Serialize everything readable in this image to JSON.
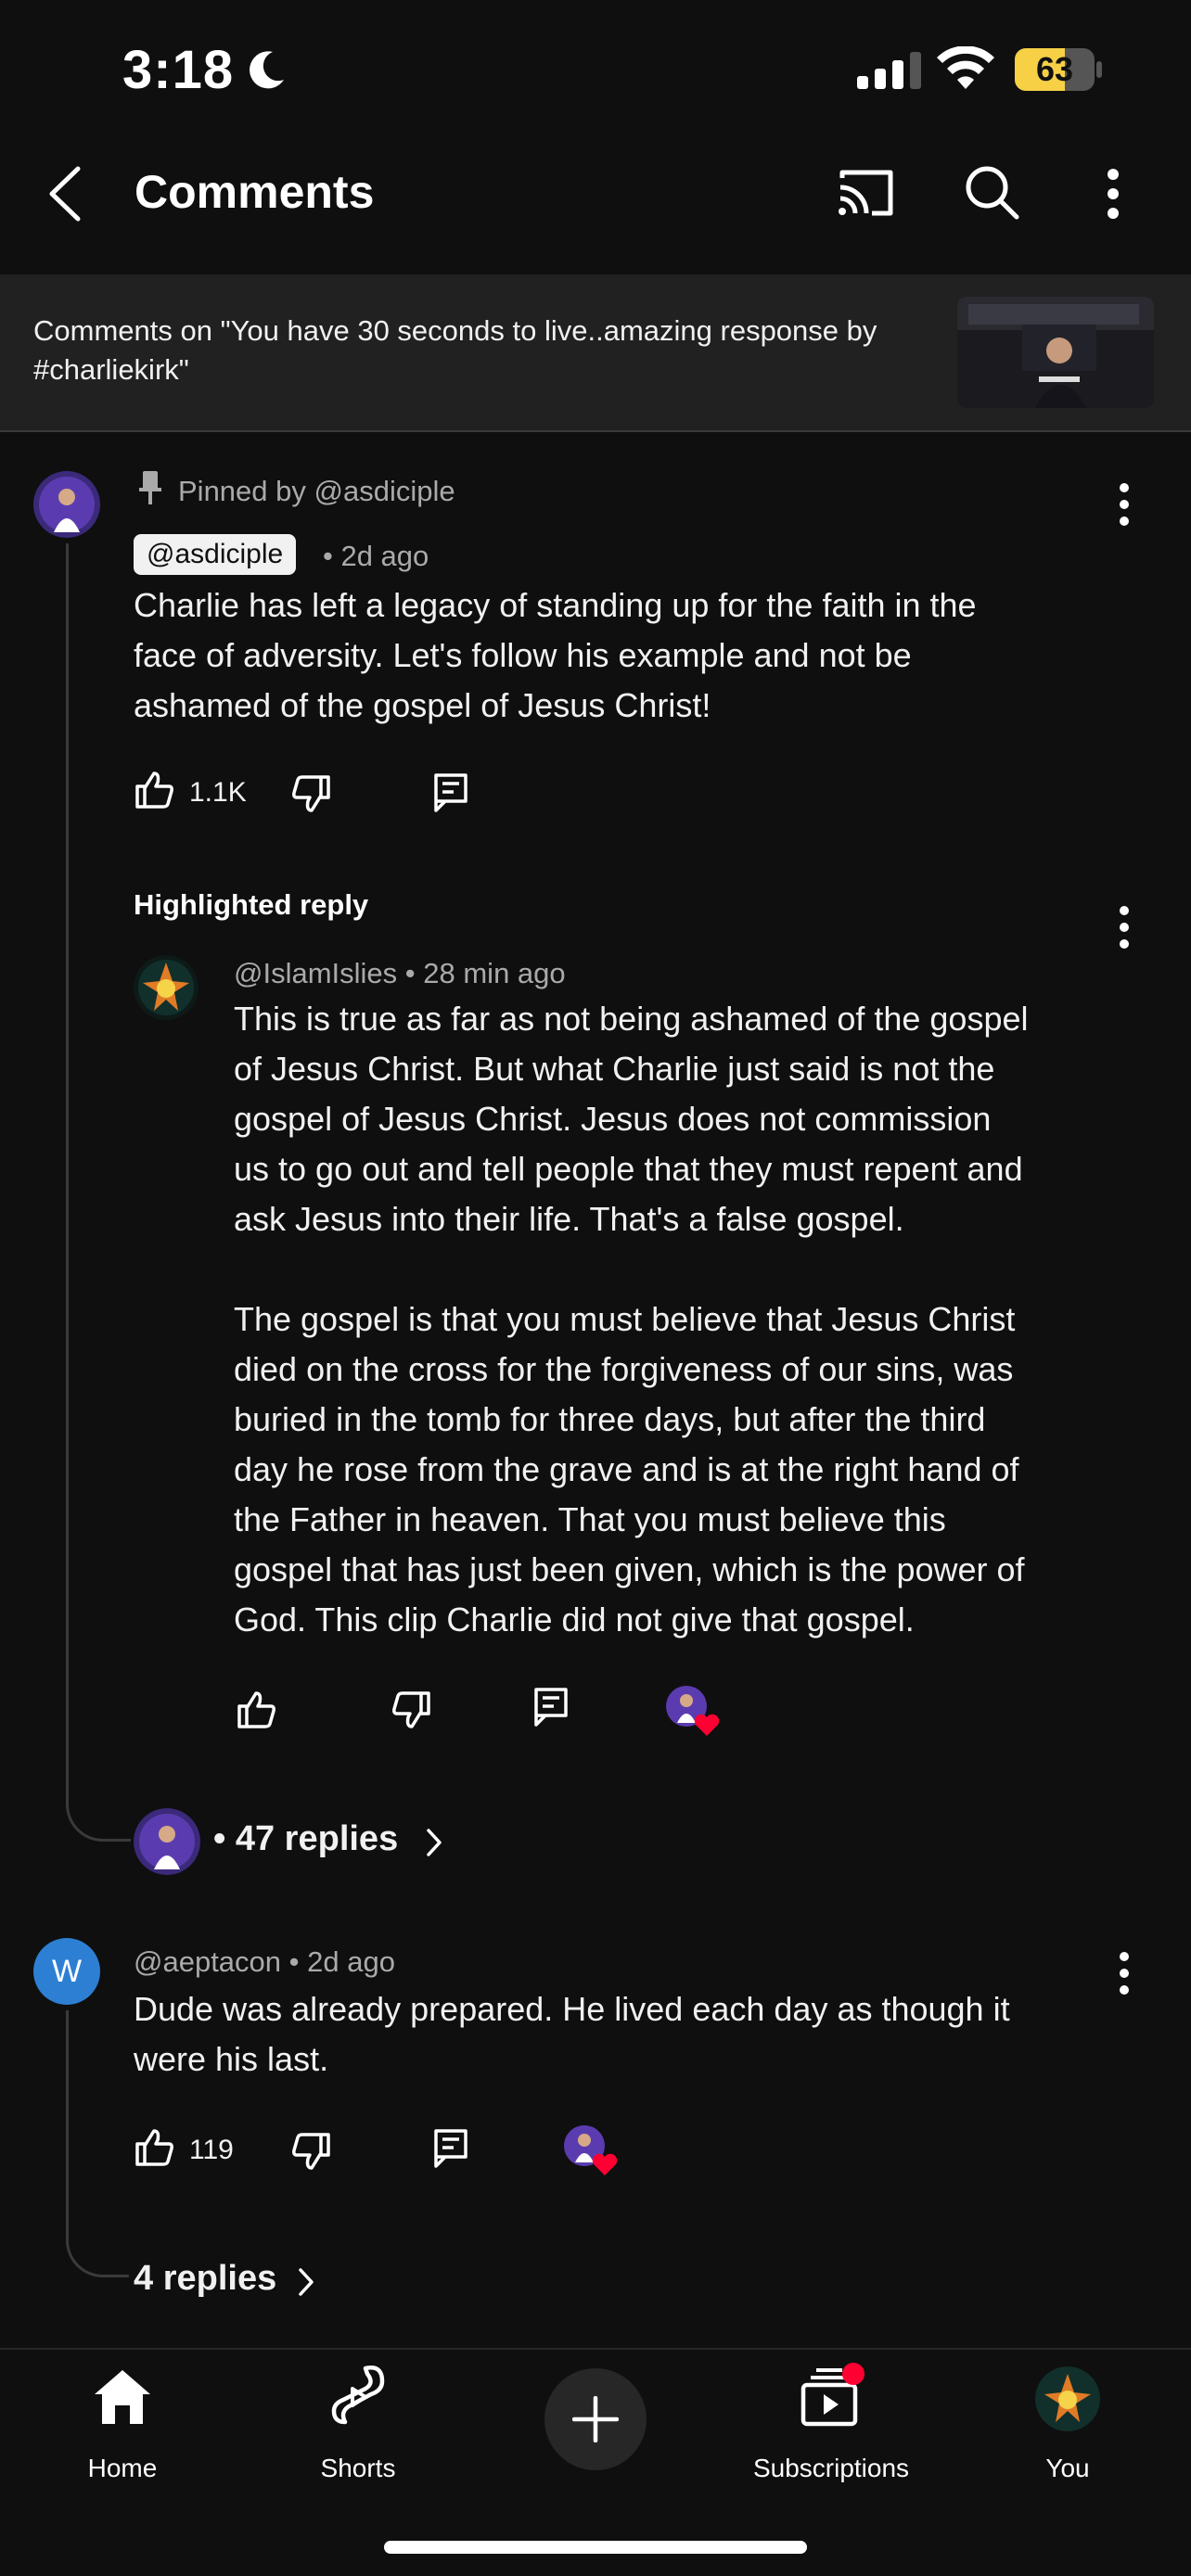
{
  "status_bar": {
    "time": "3:18",
    "battery": "63",
    "battery_percent": 63
  },
  "top_bar": {
    "title": "Comments"
  },
  "video_header": {
    "text": "Comments on \"You have 30 seconds to live..amazing response by #charliekirk\""
  },
  "pinned_comment": {
    "pinned_label": "Pinned by @asdiciple",
    "author": "@asdiciple",
    "time": "• 2d ago",
    "text_lines": [
      "Charlie has left a legacy of standing up for the faith in the",
      "face of adversity. Let's follow his example and not be",
      "ashamed of the gospel of Jesus Christ!"
    ],
    "likes": "1.1K"
  },
  "highlighted_reply": {
    "label": "Highlighted reply",
    "author": "@IslamIslies",
    "time": "• 28 min ago",
    "para1_lines": [
      "This is true as far as not being ashamed of the gospel",
      "of Jesus Christ. But what Charlie just said is not the",
      "gospel of Jesus Christ. Jesus does not commission",
      "us to go out and tell people that they must repent and",
      "ask Jesus into their life. That's a false gospel."
    ],
    "para2_lines": [
      "The gospel is that you must believe that Jesus Christ",
      "died on the cross for the forgiveness of our sins, was",
      "buried in the tomb for three days, but after the third",
      "day he rose from the grave and is at the right hand of",
      "the Father in heaven. That you must believe this",
      "gospel that has just been given, which is the power of",
      "God. This clip Charlie did not give that gospel."
    ]
  },
  "replies_link_1": {
    "text": "• 47 replies"
  },
  "comment_2": {
    "avatar_letter": "W",
    "author": "@aeptacon",
    "time": "• 2d ago",
    "text_lines": [
      "Dude was already prepared. He lived each day as though it",
      "were his last."
    ],
    "likes": "119"
  },
  "replies_link_2": {
    "text": "4 replies"
  },
  "bottom_nav": {
    "home": "Home",
    "shorts": "Shorts",
    "subscriptions": "Subscriptions",
    "you": "You"
  },
  "colors": {
    "background": "#0f0f0f",
    "header_bg": "#212121",
    "heart": "#ff0033",
    "avatar_w": "#2d7fd3",
    "battery": "#f7d046"
  }
}
